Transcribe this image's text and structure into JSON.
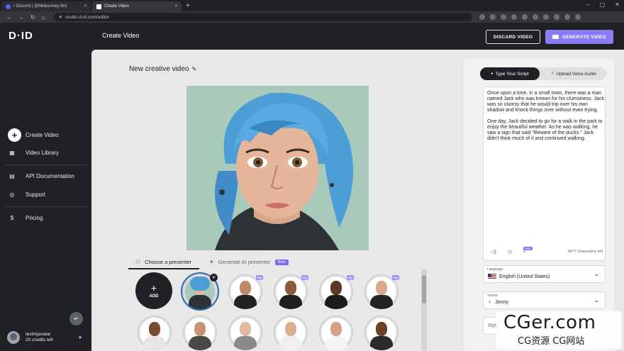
{
  "browser": {
    "tabs": [
      {
        "label": "• Discord | @Midjourney Bot"
      },
      {
        "label": "Create Video"
      }
    ],
    "new_tab": "+",
    "url": "studio.d-id.com/editor",
    "window_controls": [
      "–",
      "▢",
      "✕"
    ]
  },
  "header": {
    "logo": "D·ID",
    "page_title": "Create Video",
    "discard_label": "DISCARD VIDEO",
    "generate_label": "GENERATE VIDEO"
  },
  "sidebar": {
    "items": [
      {
        "label": "Create Video"
      },
      {
        "label": "Video Library"
      },
      {
        "label": "API Documentation"
      },
      {
        "label": "Support"
      },
      {
        "label": "Pricing"
      }
    ],
    "user": {
      "name": "testmjavatar",
      "credits": "20 credits left"
    }
  },
  "main": {
    "project_title": "New creative video",
    "presenter_tabs": {
      "choose": "Choose a presenter",
      "generate": "Generate AI presenter",
      "new_badge": "New"
    },
    "add_label": "ADD",
    "hq_badge": "HQ"
  },
  "script": {
    "tab_type": "Type Your Script",
    "tab_upload": "Upload Voice Audio",
    "text": "Once upon a time, in a small town, there was a man named Jack who was known for his clumsiness. Jack was so clumsy that he would trip over his own shadow and knock things over without even trying.\n\nOne day, Jack decided to go for a walk in the park to enjoy the beautiful weather. As he was walking, he saw a sign that said \"Beware of the ducks.\" Jack didn't think much of it and continued walking.",
    "new_badge": "New",
    "char_count": "3477 Characters left"
  },
  "settings": {
    "language_label": "Language",
    "language_value": "English (United States)",
    "voices_label": "Voices",
    "voices_value": "Jenny",
    "style_label": "Styl"
  },
  "watermark": {
    "line1": "CGer.com",
    "line2": "CG资源 CG网站"
  },
  "colors": {
    "accent": "#8b7cf6",
    "dark": "#202124",
    "panel": "#f2f2f2"
  }
}
